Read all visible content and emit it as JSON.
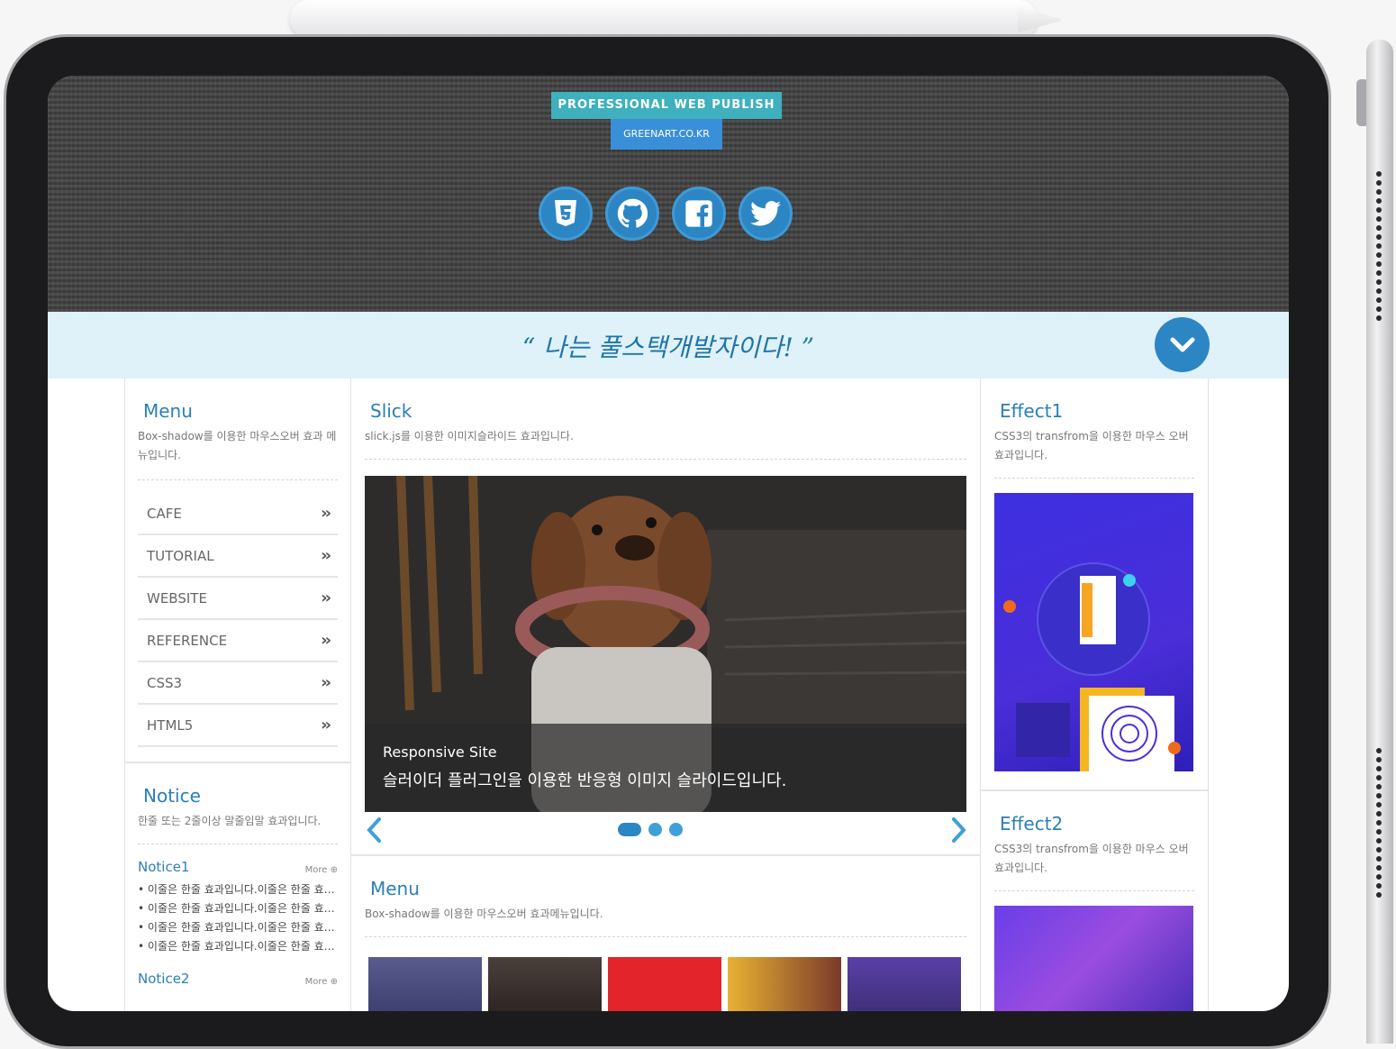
{
  "header": {
    "logo_top": "PROFESSIONAL WEB PUBLISH",
    "logo_bottom": "GREENART.CO.KR",
    "social_icons": [
      "html5-icon",
      "github-icon",
      "facebook-icon",
      "twitter-icon"
    ]
  },
  "banner": {
    "text": "“ 나는 풀스택개발자이다! ”"
  },
  "left": {
    "menu": {
      "title": "Menu",
      "desc": "Box-shadow를 이용한 마우스오버 효과 메뉴입니다.",
      "items": [
        "CAFE",
        "TUTORIAL",
        "WEBSITE",
        "REFERENCE",
        "CSS3",
        "HTML5"
      ]
    },
    "notice": {
      "title": "Notice",
      "desc": "한줄 또는 2줄이상 말줄임말 효과입니다.",
      "group1": "Notice1",
      "group2": "Notice2",
      "more": "More",
      "items": [
        "이줄은 한줄 효과입니다.이줄은 한줄 효과입니다.",
        "이줄은 한줄 효과입니다.이줄은 한줄 효과입니다.",
        "이줄은 한줄 효과입니다.이줄은 한줄 효과입니다.",
        "이줄은 한줄 효과입니다.이줄은 한줄 효과입니다."
      ]
    }
  },
  "middle": {
    "slick": {
      "title": "Slick",
      "desc": "slick.js를 이용한 이미지슬라이드 효과입니다.",
      "caption_title": "Responsive Site",
      "caption_text": "슬러이더 플러그인을 이용한 반응형 이미지 슬라이드입니다."
    },
    "menu2": {
      "title": "Menu",
      "desc": "Box-shadow를 이용한 마우스오버 효과메뉴입니다."
    }
  },
  "right": {
    "effect1": {
      "title": "Effect1",
      "desc": "CSS3의 transfrom을 이용한 마우스 오버효과입니다."
    },
    "effect2": {
      "title": "Effect2",
      "desc": "CSS3의 transfrom을 이용한 마우스 오버효과입니다."
    }
  },
  "colors": {
    "accent": "#2d86c4",
    "banner_bg": "#dff1f9",
    "logo_teal": "#3fb0bd",
    "logo_blue": "#3a8fd9"
  }
}
